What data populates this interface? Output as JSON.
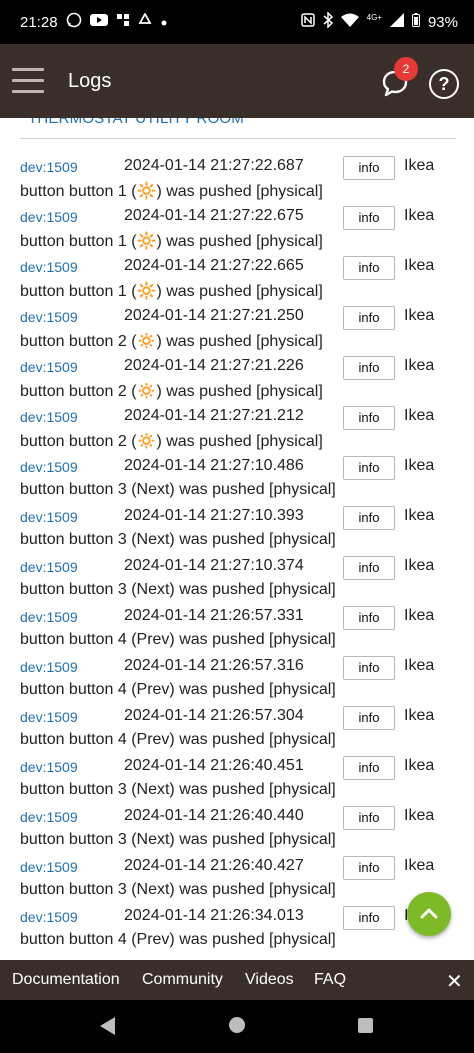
{
  "status_bar": {
    "time": "21:28",
    "network": "4G+",
    "battery": "93%",
    "icons_left": [
      "whatsapp-icon",
      "youtube-icon",
      "app-icon",
      "recycle-icon",
      "dot-icon"
    ],
    "icons_right": [
      "nfc-icon",
      "bluetooth-icon",
      "wifi-icon",
      "signal-icon",
      "battery-icon"
    ]
  },
  "app_bar": {
    "title": "Logs",
    "notification_count": "2",
    "help_glyph": "?"
  },
  "section": {
    "title": "THERMOSTAT UTILITY ROOM"
  },
  "logs": [
    {
      "dev": "dev:1509",
      "time": "2024-01-14 21:27:22.687",
      "info": "info",
      "device": "Ikea",
      "message": "button button 1 (🔆) was pushed [physical]"
    },
    {
      "dev": "dev:1509",
      "time": "2024-01-14 21:27:22.675",
      "info": "info",
      "device": "Ikea",
      "message": "button button 1 (🔆) was pushed [physical]"
    },
    {
      "dev": "dev:1509",
      "time": "2024-01-14 21:27:22.665",
      "info": "info",
      "device": "Ikea",
      "message": "button button 1 (🔆) was pushed [physical]"
    },
    {
      "dev": "dev:1509",
      "time": "2024-01-14 21:27:21.250",
      "info": "info",
      "device": "Ikea",
      "message": "button button 2 (🔅) was pushed [physical]"
    },
    {
      "dev": "dev:1509",
      "time": "2024-01-14 21:27:21.226",
      "info": "info",
      "device": "Ikea",
      "message": "button button 2 (🔅) was pushed [physical]"
    },
    {
      "dev": "dev:1509",
      "time": "2024-01-14 21:27:21.212",
      "info": "info",
      "device": "Ikea",
      "message": "button button 2 (🔅) was pushed [physical]"
    },
    {
      "dev": "dev:1509",
      "time": "2024-01-14 21:27:10.486",
      "info": "info",
      "device": "Ikea",
      "message": "button button 3 (Next) was pushed [physical]"
    },
    {
      "dev": "dev:1509",
      "time": "2024-01-14 21:27:10.393",
      "info": "info",
      "device": "Ikea",
      "message": "button button 3 (Next) was pushed [physical]"
    },
    {
      "dev": "dev:1509",
      "time": "2024-01-14 21:27:10.374",
      "info": "info",
      "device": "Ikea",
      "message": "button button 3 (Next) was pushed [physical]"
    },
    {
      "dev": "dev:1509",
      "time": "2024-01-14 21:26:57.331",
      "info": "info",
      "device": "Ikea",
      "message": "button button 4 (Prev) was pushed [physical]"
    },
    {
      "dev": "dev:1509",
      "time": "2024-01-14 21:26:57.316",
      "info": "info",
      "device": "Ikea",
      "message": "button button 4 (Prev) was pushed [physical]"
    },
    {
      "dev": "dev:1509",
      "time": "2024-01-14 21:26:57.304",
      "info": "info",
      "device": "Ikea",
      "message": "button button 4 (Prev) was pushed [physical]"
    },
    {
      "dev": "dev:1509",
      "time": "2024-01-14 21:26:40.451",
      "info": "info",
      "device": "Ikea",
      "message": "button button 3 (Next) was pushed [physical]"
    },
    {
      "dev": "dev:1509",
      "time": "2024-01-14 21:26:40.440",
      "info": "info",
      "device": "Ikea",
      "message": "button button 3 (Next) was pushed [physical]"
    },
    {
      "dev": "dev:1509",
      "time": "2024-01-14 21:26:40.427",
      "info": "info",
      "device": "Ikea",
      "message": "button button 3 (Next) was pushed [physical]"
    },
    {
      "dev": "dev:1509",
      "time": "2024-01-14 21:26:34.013",
      "info": "info",
      "device": "I",
      "message": "button button 4 (Prev) was pushed [physical]"
    }
  ],
  "footer": {
    "links": [
      "Documentation",
      "Community",
      "Videos",
      "FAQ"
    ],
    "close_glyph": "✕"
  },
  "colors": {
    "app_bar": "#3a2e2a",
    "link": "#1f6fb3",
    "fab": "#7cbb25",
    "badge": "#e53935"
  }
}
